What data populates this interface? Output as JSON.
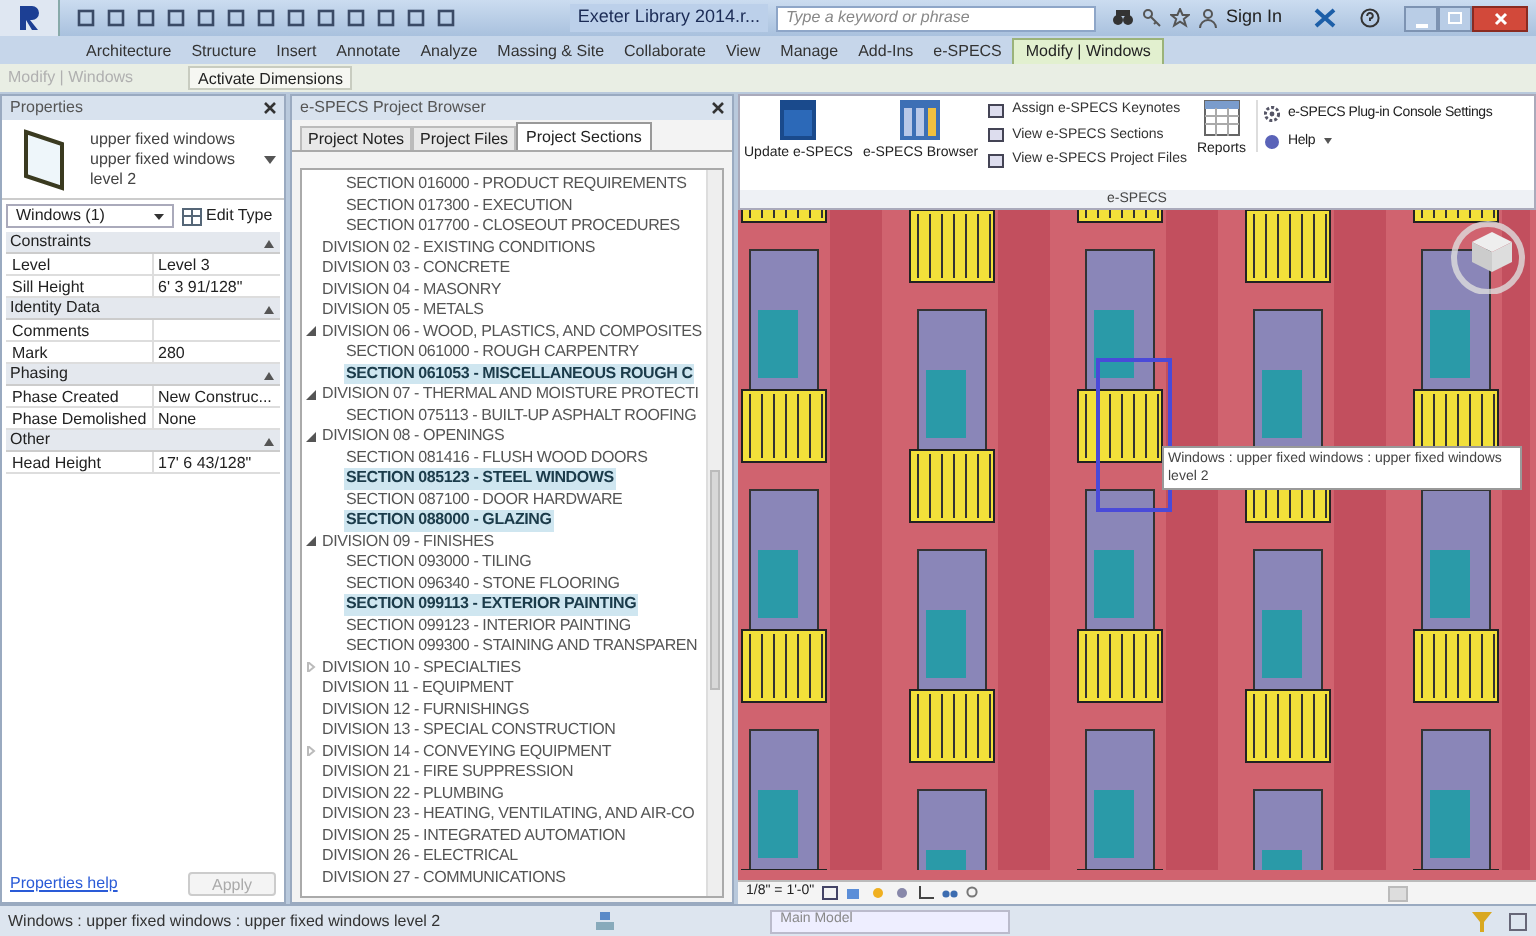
{
  "app": {
    "title": "Exeter Library 2014.r...",
    "search_placeholder": "Type a keyword or phrase",
    "sign_in": "Sign In"
  },
  "ribbon_tabs": [
    {
      "label": "Architecture",
      "selected": false
    },
    {
      "label": "Structure",
      "selected": false
    },
    {
      "label": "Insert",
      "selected": false
    },
    {
      "label": "Annotate",
      "selected": false
    },
    {
      "label": "Analyze",
      "selected": false
    },
    {
      "label": "Massing & Site",
      "selected": false
    },
    {
      "label": "Collaborate",
      "selected": false
    },
    {
      "label": "View",
      "selected": false
    },
    {
      "label": "Manage",
      "selected": false
    },
    {
      "label": "Add-Ins",
      "selected": false
    },
    {
      "label": "e-SPECS",
      "selected": false
    },
    {
      "label": "Modify | Windows",
      "selected": true
    }
  ],
  "context_bar": {
    "label": "Modify | Windows",
    "button": "Activate Dimensions"
  },
  "properties": {
    "title": "Properties",
    "type_name": "upper fixed windows",
    "type_detail": "upper fixed windows level 2",
    "instance_selector": "Windows (1)",
    "edit_type": "Edit Type",
    "groups": [
      {
        "label": "Constraints",
        "rows": [
          {
            "name": "Level",
            "value": "Level 3"
          },
          {
            "name": "Sill Height",
            "value": "6'  3 91/128\""
          }
        ]
      },
      {
        "label": "Identity Data",
        "rows": [
          {
            "name": "Comments",
            "value": ""
          },
          {
            "name": "Mark",
            "value": "280"
          }
        ]
      },
      {
        "label": "Phasing",
        "rows": [
          {
            "name": "Phase Created",
            "value": "New Construc..."
          },
          {
            "name": "Phase Demolished",
            "value": "None"
          }
        ]
      },
      {
        "label": "Other",
        "rows": [
          {
            "name": "Head Height",
            "value": "17'  6 43/128\""
          }
        ]
      }
    ],
    "help_link": "Properties help",
    "apply": {
      "label": "Apply",
      "disabled": true
    }
  },
  "browser": {
    "title": "e-SPECS Project Browser",
    "tabs": [
      {
        "label": "Project Notes",
        "selected": false
      },
      {
        "label": "Project Files",
        "selected": false
      },
      {
        "label": "Project Sections",
        "selected": true
      }
    ],
    "tree": [
      {
        "children": [
          {
            "label": "SECTION 016000 - PRODUCT REQUIREMENTS",
            "selected": false
          },
          {
            "label": "SECTION 017300 - EXECUTION",
            "selected": false
          },
          {
            "label": "SECTION 017700 - CLOSEOUT PROCEDURES",
            "selected": false
          }
        ]
      },
      {
        "label": "DIVISION 02 - EXISTING CONDITIONS"
      },
      {
        "label": "DIVISION 03 - CONCRETE"
      },
      {
        "label": "DIVISION 04 - MASONRY"
      },
      {
        "label": "DIVISION 05 - METALS"
      },
      {
        "label": "DIVISION 06 - WOOD, PLASTICS, AND COMPOSITES",
        "expanded": true,
        "children": [
          {
            "label": "SECTION 061000 - ROUGH CARPENTRY",
            "selected": false
          },
          {
            "label": "SECTION 061053 - MISCELLANEOUS ROUGH C",
            "selected": true
          }
        ]
      },
      {
        "label": "DIVISION 07 - THERMAL AND MOISTURE PROTECTI",
        "expanded": true,
        "children": [
          {
            "label": "SECTION 075113 - BUILT-UP ASPHALT ROOFING",
            "selected": false
          }
        ]
      },
      {
        "label": "DIVISION 08 - OPENINGS",
        "expanded": true,
        "children": [
          {
            "label": "SECTION 081416 - FLUSH WOOD DOORS",
            "selected": false
          },
          {
            "label": "SECTION 085123 - STEEL WINDOWS",
            "selected": true
          },
          {
            "label": "SECTION 087100 - DOOR HARDWARE",
            "selected": false
          },
          {
            "label": "SECTION 088000 - GLAZING",
            "selected": true
          }
        ]
      },
      {
        "label": "DIVISION 09 - FINISHES",
        "expanded": true,
        "children": [
          {
            "label": "SECTION 093000 - TILING",
            "selected": false
          },
          {
            "label": "SECTION 096340 - STONE FLOORING",
            "selected": false
          },
          {
            "label": "SECTION 099113 - EXTERIOR PAINTING",
            "selected": true
          },
          {
            "label": "SECTION 099123 - INTERIOR PAINTING",
            "selected": false
          },
          {
            "label": "SECTION 099300 - STAINING AND TRANSPAREN",
            "selected": false
          }
        ]
      },
      {
        "label": "DIVISION 10 - SPECIALTIES",
        "expanded": false
      },
      {
        "label": "DIVISION 11 - EQUIPMENT"
      },
      {
        "label": "DIVISION 12 - FURNISHINGS"
      },
      {
        "label": "DIVISION 13 - SPECIAL CONSTRUCTION"
      },
      {
        "label": "DIVISION 14 - CONVEYING EQUIPMENT",
        "expanded": false
      },
      {
        "label": "DIVISION 21 - FIRE SUPPRESSION"
      },
      {
        "label": "DIVISION 22 - PLUMBING"
      },
      {
        "label": "DIVISION 23 - HEATING, VENTILATING, AND AIR-CO"
      },
      {
        "label": "DIVISION 25 - INTEGRATED AUTOMATION"
      },
      {
        "label": "DIVISION 26 - ELECTRICAL"
      },
      {
        "label": "DIVISION 27 - COMMUNICATIONS"
      }
    ]
  },
  "ribbon_panel": {
    "update": "Update e-SPECS",
    "browser": "e-SPECS Browser",
    "links": [
      "Assign e-SPECS Keynotes",
      "View e-SPECS Sections",
      "View e-SPECS Project Files"
    ],
    "reports": "Reports",
    "settings": "e-SPECS Plug-in Console Settings",
    "help": "Help",
    "label": "e-SPECS"
  },
  "view": {
    "tooltip": "Windows : upper fixed windows : upper fixed windows level 2",
    "scale": "1/8\" = 1'-0\""
  },
  "status_bar": {
    "text": "Windows : upper fixed windows : upper fixed windows level 2",
    "model": "Main Model"
  }
}
